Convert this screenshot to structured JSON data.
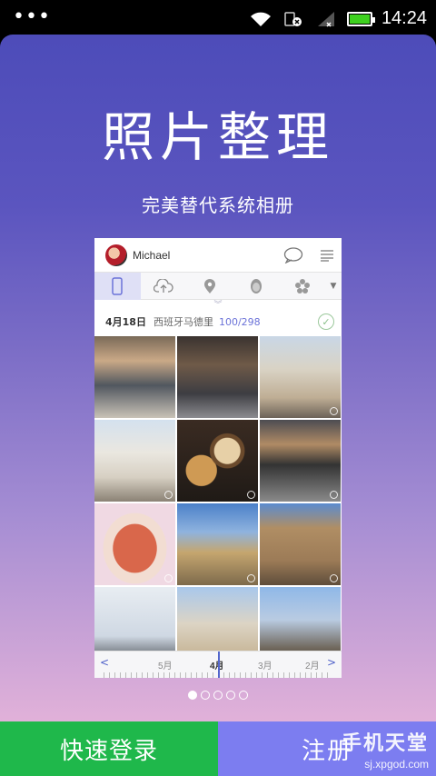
{
  "status_bar": {
    "time": "14:24",
    "menu_icon": "overflow-dots-icon",
    "icons": [
      "wifi-icon",
      "sim-off-icon",
      "signal-icon",
      "battery-icon"
    ],
    "battery_level": 1.0
  },
  "hero": {
    "title": "照片整理",
    "subtitle": "完美替代系统相册"
  },
  "preview": {
    "user_name": "Michael",
    "header_icons": [
      "chat-bubble-icon",
      "menu-lines-icon"
    ],
    "tabs": [
      "phone-icon",
      "cloud-upload-icon",
      "location-pin-icon",
      "face-icon",
      "flower-icon"
    ],
    "active_tab": 0,
    "date": "4月18日",
    "location": "西班牙马德里",
    "count": "100/298",
    "timeline": {
      "months": [
        "5月",
        "4月",
        "3月",
        "2月"
      ],
      "active_month": "4月"
    }
  },
  "pager": {
    "pages": 5,
    "active": 0
  },
  "buttons": {
    "login": "快速登录",
    "register": "注册"
  },
  "watermark": {
    "brand": "手机天堂",
    "url": "sj.xpgod.com"
  },
  "colors": {
    "login_green": "#1fb84b",
    "register_purple": "#7c7df0",
    "accent": "#5366cc"
  }
}
